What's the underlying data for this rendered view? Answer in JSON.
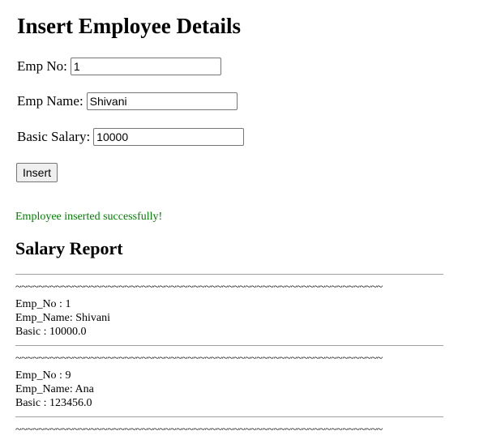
{
  "form": {
    "title": "Insert Employee Details",
    "emp_no_label": "Emp No:",
    "emp_no_value": "1",
    "emp_name_label": "Emp Name:",
    "emp_name_value": "Shivani",
    "salary_label": "Basic Salary:",
    "salary_value": "10000",
    "insert_label": "Insert"
  },
  "message": {
    "text": "Employee inserted successfully!",
    "color": "#008000"
  },
  "report": {
    "title": "Salary Report",
    "separator": "~~~~~~~~~~~~~~~~~~~~~~~~~~~~~~~~~~~~~~~~~~~~~~~~~~~~~~~~~~~~~~~~",
    "records": [
      {
        "emp_no": "Emp_No : 1",
        "emp_name": "Emp_Name: Shivani",
        "basic": "Basic : 10000.0"
      },
      {
        "emp_no": "Emp_No : 9",
        "emp_name": "Emp_Name: Ana",
        "basic": "Basic : 123456.0"
      }
    ]
  }
}
